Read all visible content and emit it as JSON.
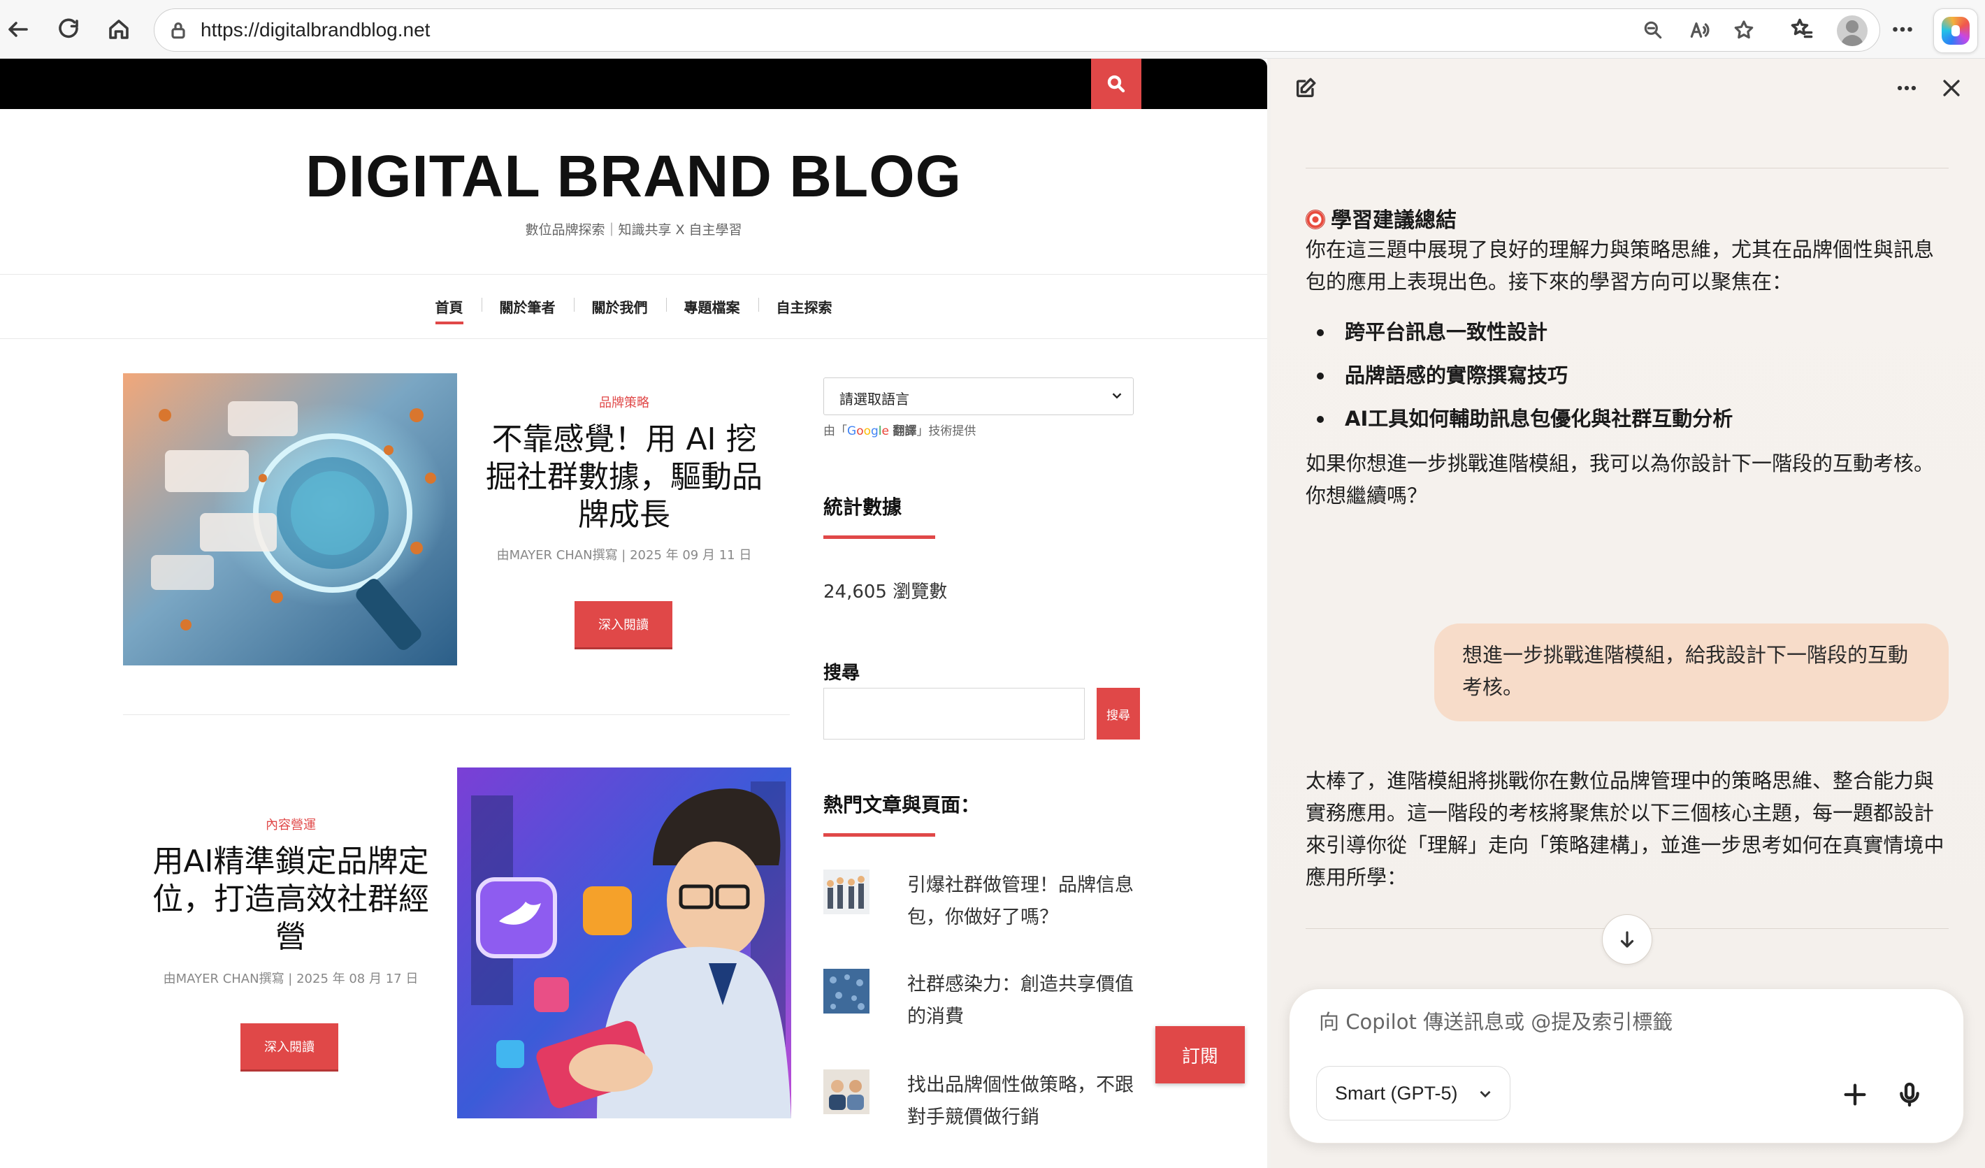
{
  "browser": {
    "url": "https://digitalbrandblog.net"
  },
  "site": {
    "title": "DIGITAL BRAND BLOG",
    "tagline": "數位品牌探索｜知識共享 X 自主學習",
    "nav": [
      "首頁",
      "關於筆者",
      "關於我們",
      "專題檔案",
      "自主探索"
    ],
    "posts": [
      {
        "category": "品牌策略",
        "title": "不靠感覺！用 AI 挖掘社群數據，驅動品牌成長",
        "meta": "由MAYER CHAN撰寫 | 2025 年 09 月 11 日",
        "button": "深入閱讀"
      },
      {
        "category": "內容營運",
        "title": "用AI精準鎖定品牌定位，打造高效社群經營",
        "meta": "由MAYER CHAN撰寫 | 2025 年 08 月 17 日",
        "button": "深入閱讀"
      }
    ],
    "sidebar": {
      "language_select": "請選取語言",
      "powered_prefix": "由「",
      "powered_google": [
        "G",
        "o",
        "o",
        "g",
        "l",
        "e"
      ],
      "powered_translate": "翻譯",
      "powered_suffix": "」技術提供",
      "stats_title": "統計數據",
      "stats_value": "24,605 瀏覽數",
      "search_label": "搜尋",
      "search_button": "搜尋",
      "popular_title": "熱門文章與頁面：",
      "popular": [
        "引爆社群做管理！品牌信息包，你做好了嗎？",
        "社群感染力：創造共享價值的消費",
        "找出品牌個性做策略，不跟對手競價做行銷"
      ],
      "subscribe": "訂閱"
    }
  },
  "copilot": {
    "heading": "學習建議總結",
    "intro": "你在這三題中展現了良好的理解力與策略思維，尤其在品牌個性與訊息包的應用上表現出色。接下來的學習方向可以聚焦在：",
    "bullets": [
      "跨平台訊息一致性設計",
      "品牌語感的實際撰寫技巧",
      "AI工具如何輔助訊息包優化與社群互動分析"
    ],
    "followup": "如果你想進一步挑戰進階模組，我可以為你設計下一階段的互動考核。你想繼續嗎？",
    "user_message": "想進一步挑戰進階模組，給我設計下一階段的互動考核。",
    "reply": "太棒了，進階模組將挑戰你在數位品牌管理中的策略思維、整合能力與實務應用。這一階段的考核將聚焦於以下三個核心主題，每一題都設計來引導你從「理解」走向「策略建構」，並進一步思考如何在真實情境中應用所學：",
    "composer_placeholder": "向 Copilot 傳送訊息或 @提及索引標籤",
    "model": "Smart (GPT-5)"
  },
  "colors": {
    "accent": "#e04848",
    "bubble": "#f7dcc9"
  }
}
